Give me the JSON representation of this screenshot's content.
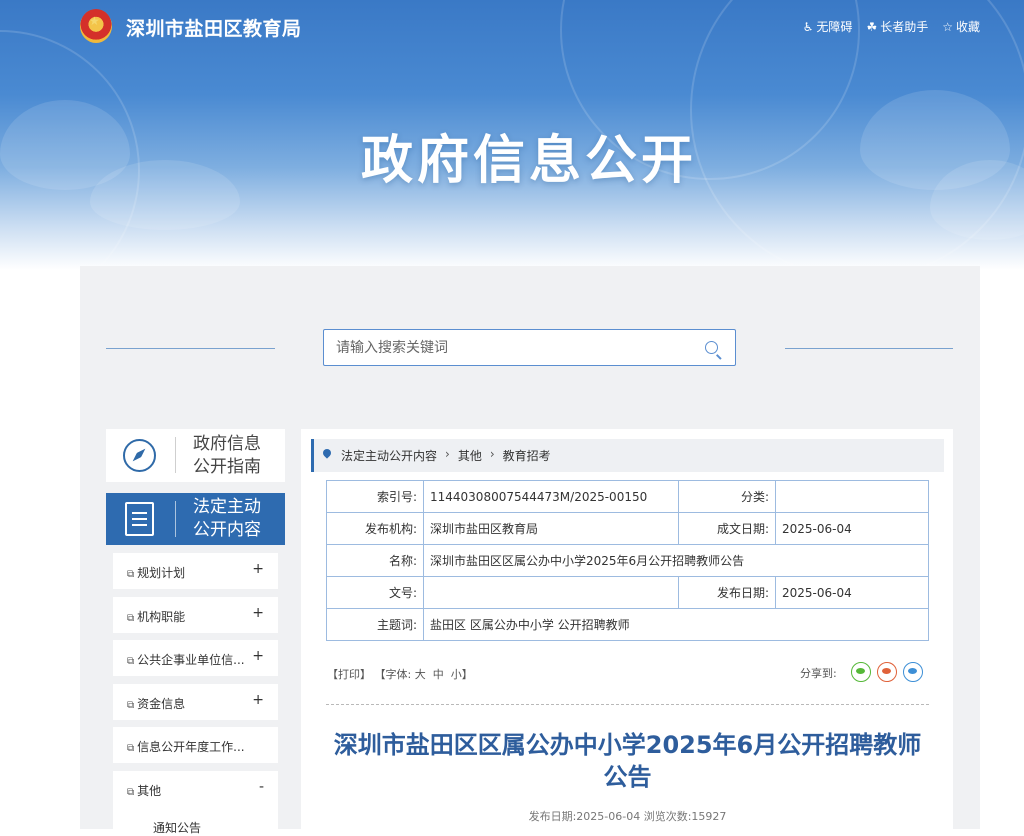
{
  "header": {
    "site_title": "深圳市盐田区教育局",
    "links": [
      {
        "icon": "accessibility-icon",
        "label": "无障碍"
      },
      {
        "icon": "elderly-helper-icon",
        "label": "长者助手"
      },
      {
        "icon": "star-icon",
        "label": "收藏"
      }
    ]
  },
  "banner": {
    "title": "政府信息公开"
  },
  "search": {
    "placeholder": "请输入搜索关键词"
  },
  "sidebar": {
    "guide": {
      "line1": "政府信息",
      "line2": "公开指南"
    },
    "active": {
      "line1": "法定主动",
      "line2": "公开内容"
    },
    "items": [
      {
        "label": "规划计划",
        "toggle": "+"
      },
      {
        "label": "机构职能",
        "toggle": "+"
      },
      {
        "label": "公共企事业单位信...",
        "toggle": "+"
      },
      {
        "label": "资金信息",
        "toggle": "+"
      },
      {
        "label": "信息公开年度工作...",
        "toggle": ""
      },
      {
        "label": "其他",
        "toggle": "-"
      }
    ],
    "subitem": "通知公告"
  },
  "breadcrumb": [
    "法定主动公开内容",
    "其他",
    "教育招考"
  ],
  "meta": {
    "index_label": "索引号:",
    "index_value": "11440308007544473M/2025-00150",
    "category_label": "分类:",
    "category_value": "",
    "publisher_label": "发布机构:",
    "publisher_value": "深圳市盐田区教育局",
    "created_label": "成文日期:",
    "created_value": "2025-06-04",
    "name_label": "名称:",
    "name_value": "深圳市盐田区区属公办中小学2025年6月公开招聘教师公告",
    "docno_label": "文号:",
    "docno_value": "",
    "pubdate_label": "发布日期:",
    "pubdate_value": "2025-06-04",
    "subject_label": "主题词:",
    "subject_value": "盐田区 区属公办中小学 公开招聘教师"
  },
  "tools": {
    "print": "【打印】",
    "font_prefix": "【字体:",
    "font_large": "大",
    "font_medium": "中",
    "font_small": "小",
    "font_suffix": "】",
    "share_label": "分享到:"
  },
  "article": {
    "title": "深圳市盐田区区属公办中小学2025年6月公开招聘教师公告",
    "pubinfo": "发布日期:2025-06-04  浏览次数:15927"
  },
  "colors": {
    "brand": "#2e6bb0",
    "title": "#2e5d9c",
    "border": "#9dbbe0"
  }
}
